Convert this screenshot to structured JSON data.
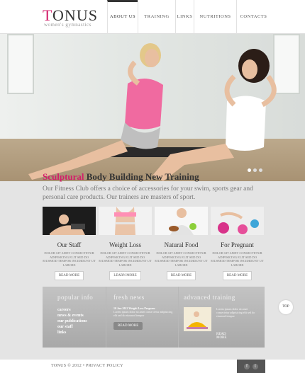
{
  "brand": {
    "logo_first": "T",
    "logo_rest": "ONUS",
    "tagline": "women's gymnastics"
  },
  "nav": {
    "items": [
      {
        "label": "About us",
        "active": true
      },
      {
        "label": "Training",
        "active": false
      },
      {
        "label": "Links",
        "active": false
      },
      {
        "label": "Nutritions",
        "active": false
      },
      {
        "label": "Contacts",
        "active": false
      }
    ]
  },
  "hero": {
    "slides_total": 3,
    "slide_active": 1
  },
  "feature": {
    "title_highlight": "Sculptural",
    "title_rest": " Body Building New Training",
    "text": "Our Fitness Club offers a choice of accessories for your swim, sports gear and personal care products. Our trainers are masters of sport."
  },
  "cards": [
    {
      "title": "Our Staff",
      "text": "Dolor sit amet consectetur adipisicing elit sed do eiusmod tempor incididunt ut labore",
      "button": "Read more",
      "icon": "staff-photo"
    },
    {
      "title": "Weight Loss",
      "text": "Dolor sit amet consectetur adipisicing elit sed do eiusmod tempor incididunt ut labore",
      "button": "Learn more",
      "icon": "weight-loss-photo"
    },
    {
      "title": "Natural Food",
      "text": "Dolor sit amet consectetur adipisicing elit sed do eiusmod tempor incididunt ut labore",
      "button": "Read more",
      "icon": "natural-food-photo"
    },
    {
      "title": "For Pregnant",
      "text": "Dolor sit amet consectetur adipisicing elit sed do eiusmod tempor incididunt ut labore",
      "button": "Read more",
      "icon": "pregnant-photo"
    }
  ],
  "panel": {
    "popular_title": "popular info",
    "popular_links": [
      "careers",
      "news & events",
      "our publications",
      "our staff",
      "links"
    ],
    "news_title": "fresh news",
    "news_head": "10 Jun 2012 Weight Loss Program",
    "news_text": "Lorem ipsum dolor sit amet conse ctetur adipisicing elit sed do eiusmod tempor",
    "news_button": "Read more",
    "adv_title": "advanced training",
    "adv_text": "Lorem ipsum dolor sit amet consectetur adipisicing elit sed do eiusmod tempor",
    "adv_button": "Read more"
  },
  "top_button": "TOP",
  "footer": {
    "copyright": "TONUS © 2012 • PRIVACY POLICY",
    "social": [
      "f",
      "t"
    ]
  },
  "colors": {
    "accent": "#d21e6a",
    "panel": "#b3b3b3",
    "footer_dark": "#555555"
  }
}
